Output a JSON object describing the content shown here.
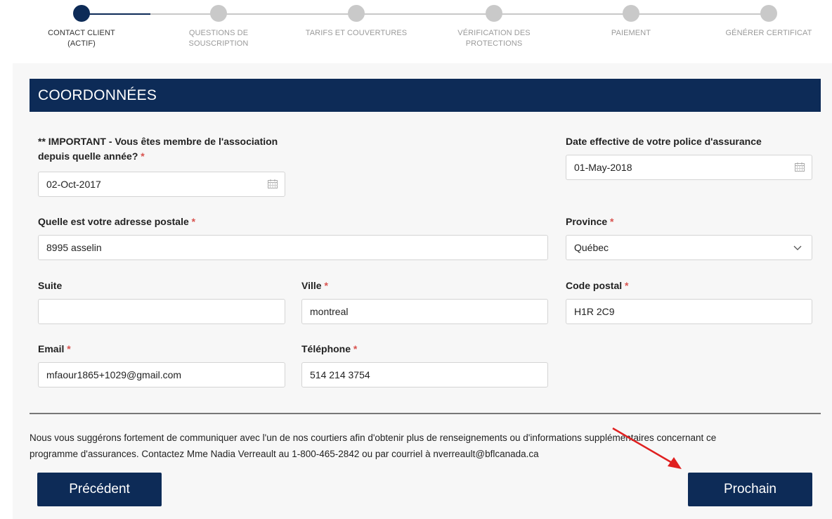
{
  "stepper": {
    "steps": [
      {
        "label": "CONTACT CLIENT",
        "sub": "(ACTIF)",
        "active": true
      },
      {
        "label": "QUESTIONS DE SOUSCRIPTION",
        "sub": "",
        "active": false
      },
      {
        "label": "TARIFS ET COUVERTURES",
        "sub": "",
        "active": false
      },
      {
        "label": "VÉRIFICATION DES PROTECTIONS",
        "sub": "",
        "active": false
      },
      {
        "label": "PAIEMENT",
        "sub": "",
        "active": false
      },
      {
        "label": "GÉNÉRER CERTIFICAT",
        "sub": "",
        "active": false
      }
    ]
  },
  "section": {
    "title": "COORDONNÉES"
  },
  "form": {
    "member_since": {
      "label_line1": "** IMPORTANT - Vous êtes membre de l'association",
      "label_line2": "depuis quelle année?",
      "required": "*",
      "value": "02-Oct-2017",
      "icon": "calendar-icon"
    },
    "effective_date": {
      "label": "Date effective de votre police d'assurance",
      "value": "01-May-2018",
      "icon": "calendar-icon"
    },
    "address": {
      "label": "Quelle est votre adresse postale",
      "required": "*",
      "value": "8995 asselin"
    },
    "province": {
      "label": "Province",
      "required": "*",
      "value": "Québec",
      "icon": "chevron-down-icon"
    },
    "suite": {
      "label": "Suite",
      "value": ""
    },
    "city": {
      "label": "Ville",
      "required": "*",
      "value": "montreal"
    },
    "postal_code": {
      "label": "Code postal",
      "required": "*",
      "value": "H1R 2C9"
    },
    "email": {
      "label": "Email",
      "required": "*",
      "value": "mfaour1865+1029@gmail.com"
    },
    "phone": {
      "label": "Téléphone",
      "required": "*",
      "value": "514 214 3754"
    }
  },
  "note": {
    "line1": "Nous vous suggérons fortement de communiquer avec l'un de nos courtiers afin d'obtenir plus de renseignements ou d'informations supplémentaires concernant ce",
    "line2": "programme d'assurances. Contactez Mme Nadia Verreault au 1-800-465-2842 ou par courriel à nverreault@bflcanada.ca"
  },
  "buttons": {
    "previous": "Précédent",
    "next": "Prochain"
  },
  "colors": {
    "primary": "#0d2b57",
    "required": "#d9534f",
    "annotation_arrow": "#e02020",
    "inactive_step": "#c9c9c9"
  }
}
